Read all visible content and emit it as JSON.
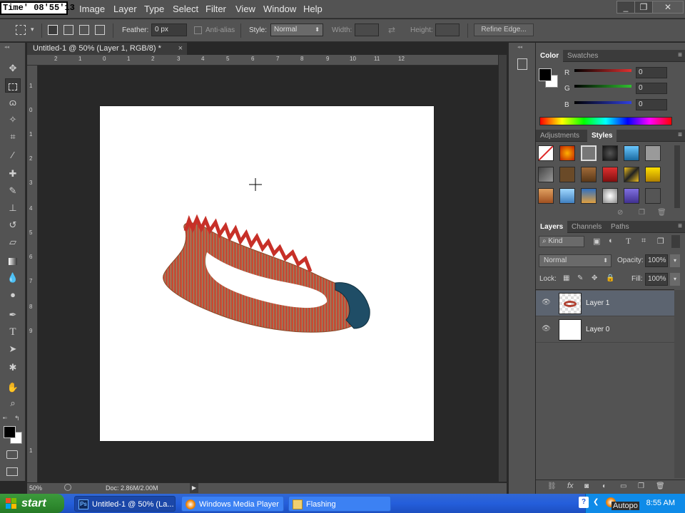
{
  "overlay": {
    "recording_timer": "Time' 08'55'13"
  },
  "menubar": {
    "items": [
      "Image",
      "Layer",
      "Type",
      "Select",
      "Filter",
      "View",
      "Window",
      "Help"
    ],
    "window_controls": [
      "_",
      "❐",
      "✕"
    ]
  },
  "options_bar": {
    "feather_label": "Feather:",
    "feather_value": "0 px",
    "anti_alias_label": "Anti-alias",
    "style_label": "Style:",
    "style_value": "Normal",
    "width_label": "Width:",
    "height_label": "Height:",
    "refine_edge_label": "Refine Edge..."
  },
  "document": {
    "tab_title": "Untitled-1 @ 50% (Layer 1, RGB/8) *",
    "tab_close": "×",
    "ruler_h_numbers": [
      "2",
      "1",
      "0",
      "1",
      "2",
      "3",
      "4",
      "5",
      "6",
      "7",
      "8",
      "9",
      "10",
      "11",
      "12"
    ],
    "ruler_v_numbers": [
      "1",
      "0",
      "1",
      "2",
      "3",
      "4",
      "5",
      "6",
      "7",
      "8",
      "9",
      "1"
    ]
  },
  "status_bar": {
    "zoom": "50%",
    "doc_info": "Doc: 2.86M/2.00M"
  },
  "panels": {
    "color_panel": {
      "tabs": [
        "Color",
        "Swatches"
      ],
      "active_tab": "Color",
      "channels": [
        {
          "label": "R",
          "value": "0",
          "color": "#d23a3a"
        },
        {
          "label": "G",
          "value": "0",
          "color": "#3ab83a"
        },
        {
          "label": "B",
          "value": "0",
          "color": "#3a4ad2"
        }
      ]
    },
    "styles_panel": {
      "tabs": [
        "Adjustments",
        "Styles"
      ],
      "active_tab": "Styles"
    },
    "layers_panel": {
      "tabs": [
        "Layers",
        "Channels",
        "Paths"
      ],
      "active_tab": "Layers",
      "filter_kind": "Kind",
      "blend_mode": "Normal",
      "opacity_label": "Opacity:",
      "opacity_value": "100%",
      "lock_label": "Lock:",
      "fill_label": "Fill:",
      "fill_value": "100%",
      "layers": [
        {
          "name": "Layer 1",
          "selected": true
        },
        {
          "name": "Layer 0",
          "selected": false
        }
      ]
    }
  },
  "taskbar": {
    "start_label": "start",
    "buttons": [
      {
        "label": "Untitled-1 @ 50% (La...",
        "icon": "photoshop-icon",
        "active": true
      },
      {
        "label": "Windows Media Player",
        "icon": "media-player-icon",
        "active": false
      },
      {
        "label": "Flashing",
        "icon": "folder-icon",
        "active": false
      }
    ],
    "tray_overlay_text": "Autopo",
    "clock": "8:55 AM"
  },
  "colors": {
    "ui_gray": "#535353",
    "canvas_bg": "#282828",
    "taskbar_blue": "#245edb",
    "start_green": "#2f8a2f"
  }
}
